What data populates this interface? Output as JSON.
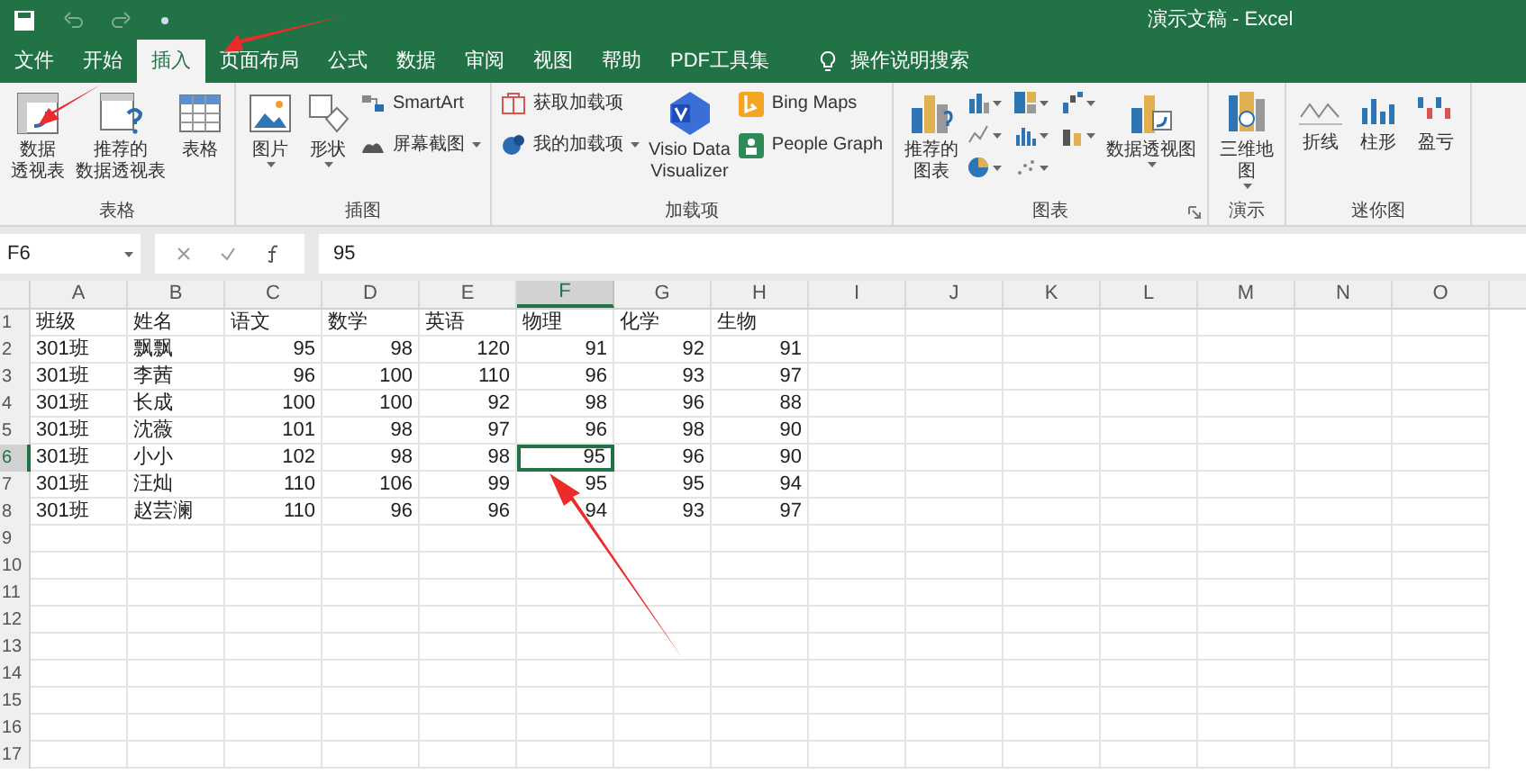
{
  "title_bar": {
    "title": "演示文稿 - Excel"
  },
  "tabs": [
    {
      "label": "文件",
      "selected": false
    },
    {
      "label": "开始",
      "selected": false
    },
    {
      "label": "插入",
      "selected": true
    },
    {
      "label": "页面布局",
      "selected": false
    },
    {
      "label": "公式",
      "selected": false
    },
    {
      "label": "数据",
      "selected": false
    },
    {
      "label": "审阅",
      "selected": false
    },
    {
      "label": "视图",
      "selected": false
    },
    {
      "label": "帮助",
      "selected": false
    },
    {
      "label": "PDF工具集",
      "selected": false
    }
  ],
  "search_hint": "操作说明搜索",
  "ribbon_groups": [
    {
      "name": "表格",
      "items": [
        {
          "kind": "large",
          "lines": [
            "数据",
            "透视表"
          ]
        },
        {
          "kind": "large",
          "lines": [
            "推荐的",
            "数据透视表"
          ]
        },
        {
          "kind": "large",
          "lines": [
            "表格"
          ]
        }
      ]
    },
    {
      "name": "插图",
      "items": [
        {
          "kind": "large",
          "lines": [
            "图片"
          ],
          "dropdown": true
        },
        {
          "kind": "large",
          "lines": [
            "形状"
          ],
          "dropdown": true
        },
        {
          "kind": "stack",
          "entries": [
            {
              "label": "SmartArt",
              "dropdown": false
            },
            {
              "label": "屏幕截图",
              "dropdown": true
            }
          ]
        }
      ]
    },
    {
      "name": "加载项",
      "items": [
        {
          "kind": "stack",
          "entries": [
            {
              "label": "获取加载项",
              "dropdown": false
            },
            {
              "label": "我的加载项",
              "dropdown": true
            }
          ]
        },
        {
          "kind": "large",
          "lines": [
            "Visio Data",
            "Visualizer"
          ]
        },
        {
          "kind": "stack",
          "entries": [
            {
              "label": "Bing Maps",
              "dropdown": false
            },
            {
              "label": "People Graph",
              "dropdown": false
            }
          ]
        }
      ]
    },
    {
      "name": "图表",
      "launcher": true,
      "items": [
        {
          "kind": "large",
          "lines": [
            "推荐的",
            "图表"
          ]
        },
        {
          "kind": "chartgrid"
        },
        {
          "kind": "large",
          "lines": [
            "数据透视图"
          ],
          "dropdown": true
        }
      ]
    },
    {
      "name": "演示",
      "items": [
        {
          "kind": "large",
          "lines": [
            "三维地",
            "图"
          ],
          "dropdown": true
        }
      ]
    },
    {
      "name": "迷你图",
      "items": [
        {
          "kind": "large",
          "lines": [
            "折线"
          ]
        },
        {
          "kind": "large",
          "lines": [
            "柱形"
          ]
        },
        {
          "kind": "large",
          "lines": [
            "盈亏"
          ]
        }
      ]
    }
  ],
  "formula_bar": {
    "name_box": "F6",
    "formula": "95"
  },
  "columns": [
    {
      "label": "A",
      "selected": false
    },
    {
      "label": "B",
      "selected": false
    },
    {
      "label": "C",
      "selected": false
    },
    {
      "label": "D",
      "selected": false
    },
    {
      "label": "E",
      "selected": false
    },
    {
      "label": "F",
      "selected": true
    },
    {
      "label": "G",
      "selected": false
    },
    {
      "label": "H",
      "selected": false
    },
    {
      "label": "I",
      "selected": false
    },
    {
      "label": "J",
      "selected": false
    },
    {
      "label": "K",
      "selected": false
    },
    {
      "label": "L",
      "selected": false
    },
    {
      "label": "M",
      "selected": false
    },
    {
      "label": "N",
      "selected": false
    },
    {
      "label": "O",
      "selected": false
    }
  ],
  "rows": [
    {
      "label": "1",
      "selected": false,
      "cells": [
        {
          "text": "班级",
          "kind": "text",
          "selected": false
        },
        {
          "text": "姓名",
          "kind": "text",
          "selected": false
        },
        {
          "text": "语文",
          "kind": "text",
          "selected": false
        },
        {
          "text": "数学",
          "kind": "text",
          "selected": false
        },
        {
          "text": "英语",
          "kind": "text",
          "selected": false
        },
        {
          "text": "物理",
          "kind": "text",
          "selected": false
        },
        {
          "text": "化学",
          "kind": "text",
          "selected": false
        },
        {
          "text": "生物",
          "kind": "text",
          "selected": false
        }
      ]
    },
    {
      "label": "2",
      "selected": false,
      "cells": [
        {
          "text": "301班",
          "kind": "text",
          "selected": false
        },
        {
          "text": "飘飘",
          "kind": "text",
          "selected": false
        },
        {
          "text": "95",
          "kind": "number",
          "selected": false
        },
        {
          "text": "98",
          "kind": "number",
          "selected": false
        },
        {
          "text": "120",
          "kind": "number",
          "selected": false
        },
        {
          "text": "91",
          "kind": "number",
          "selected": false
        },
        {
          "text": "92",
          "kind": "number",
          "selected": false
        },
        {
          "text": "91",
          "kind": "number",
          "selected": false
        }
      ]
    },
    {
      "label": "3",
      "selected": false,
      "cells": [
        {
          "text": "301班",
          "kind": "text",
          "selected": false
        },
        {
          "text": "李茜",
          "kind": "text",
          "selected": false
        },
        {
          "text": "96",
          "kind": "number",
          "selected": false
        },
        {
          "text": "100",
          "kind": "number",
          "selected": false
        },
        {
          "text": "110",
          "kind": "number",
          "selected": false
        },
        {
          "text": "96",
          "kind": "number",
          "selected": false
        },
        {
          "text": "93",
          "kind": "number",
          "selected": false
        },
        {
          "text": "97",
          "kind": "number",
          "selected": false
        }
      ]
    },
    {
      "label": "4",
      "selected": false,
      "cells": [
        {
          "text": "301班",
          "kind": "text",
          "selected": false
        },
        {
          "text": "长成",
          "kind": "text",
          "selected": false
        },
        {
          "text": "100",
          "kind": "number",
          "selected": false
        },
        {
          "text": "100",
          "kind": "number",
          "selected": false
        },
        {
          "text": "92",
          "kind": "number",
          "selected": false
        },
        {
          "text": "98",
          "kind": "number",
          "selected": false
        },
        {
          "text": "96",
          "kind": "number",
          "selected": false
        },
        {
          "text": "88",
          "kind": "number",
          "selected": false
        }
      ]
    },
    {
      "label": "5",
      "selected": false,
      "cells": [
        {
          "text": "301班",
          "kind": "text",
          "selected": false
        },
        {
          "text": "沈薇",
          "kind": "text",
          "selected": false
        },
        {
          "text": "101",
          "kind": "number",
          "selected": false
        },
        {
          "text": "98",
          "kind": "number",
          "selected": false
        },
        {
          "text": "97",
          "kind": "number",
          "selected": false
        },
        {
          "text": "96",
          "kind": "number",
          "selected": false
        },
        {
          "text": "98",
          "kind": "number",
          "selected": false
        },
        {
          "text": "90",
          "kind": "number",
          "selected": false
        }
      ]
    },
    {
      "label": "6",
      "selected": true,
      "cells": [
        {
          "text": "301班",
          "kind": "text",
          "selected": false
        },
        {
          "text": "小小",
          "kind": "text",
          "selected": false
        },
        {
          "text": "102",
          "kind": "number",
          "selected": false
        },
        {
          "text": "98",
          "kind": "number",
          "selected": false
        },
        {
          "text": "98",
          "kind": "number",
          "selected": false
        },
        {
          "text": "95",
          "kind": "number",
          "selected": true
        },
        {
          "text": "96",
          "kind": "number",
          "selected": false
        },
        {
          "text": "90",
          "kind": "number",
          "selected": false
        }
      ]
    },
    {
      "label": "7",
      "selected": false,
      "cells": [
        {
          "text": "301班",
          "kind": "text",
          "selected": false
        },
        {
          "text": "汪灿",
          "kind": "text",
          "selected": false
        },
        {
          "text": "110",
          "kind": "number",
          "selected": false
        },
        {
          "text": "106",
          "kind": "number",
          "selected": false
        },
        {
          "text": "99",
          "kind": "number",
          "selected": false
        },
        {
          "text": "95",
          "kind": "number",
          "selected": false
        },
        {
          "text": "95",
          "kind": "number",
          "selected": false
        },
        {
          "text": "94",
          "kind": "number",
          "selected": false
        }
      ]
    },
    {
      "label": "8",
      "selected": false,
      "cells": [
        {
          "text": "301班",
          "kind": "text",
          "selected": false
        },
        {
          "text": "赵芸澜",
          "kind": "text",
          "selected": false
        },
        {
          "text": "110",
          "kind": "number",
          "selected": false
        },
        {
          "text": "96",
          "kind": "number",
          "selected": false
        },
        {
          "text": "96",
          "kind": "number",
          "selected": false
        },
        {
          "text": "94",
          "kind": "number",
          "selected": false
        },
        {
          "text": "93",
          "kind": "number",
          "selected": false
        },
        {
          "text": "97",
          "kind": "number",
          "selected": false
        }
      ]
    },
    {
      "label": "9",
      "selected": false,
      "cells": []
    },
    {
      "label": "10",
      "selected": false,
      "cells": []
    },
    {
      "label": "11",
      "selected": false,
      "cells": []
    },
    {
      "label": "12",
      "selected": false,
      "cells": []
    },
    {
      "label": "13",
      "selected": false,
      "cells": []
    },
    {
      "label": "14",
      "selected": false,
      "cells": []
    },
    {
      "label": "15",
      "selected": false,
      "cells": []
    },
    {
      "label": "16",
      "selected": false,
      "cells": []
    },
    {
      "label": "17",
      "selected": false,
      "cells": []
    }
  ]
}
